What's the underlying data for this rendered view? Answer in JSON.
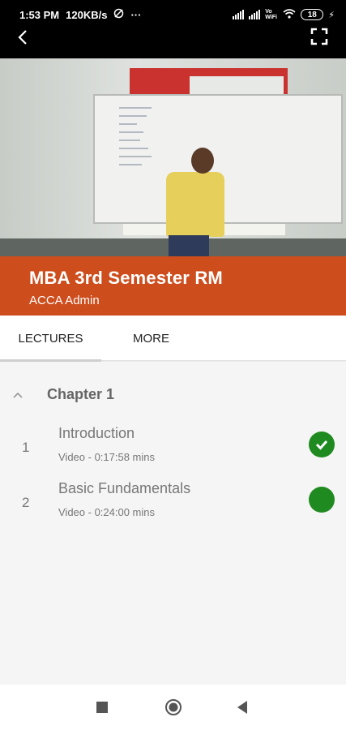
{
  "status_bar": {
    "time": "1:53 PM",
    "speed": "120KB/s",
    "more": "···",
    "volte": "Vo WiFi",
    "battery": "18"
  },
  "video": {
    "icons": {
      "back": "back-arrow-icon",
      "fullscreen": "fullscreen-icon"
    }
  },
  "course": {
    "title": "MBA 3rd Semester RM",
    "author": "ACCA Admin"
  },
  "tabs": [
    {
      "label": "LECTURES",
      "selected": true
    },
    {
      "label": "MORE",
      "selected": false
    }
  ],
  "chapter": {
    "title": "Chapter 1",
    "expanded": true,
    "lectures": [
      {
        "number": "1",
        "title": "Introduction",
        "meta": "Video - 0:17:58 mins",
        "status": "completed"
      },
      {
        "number": "2",
        "title": "Basic Fundamentals",
        "meta": "Video - 0:24:00 mins",
        "status": "in-progress"
      }
    ]
  },
  "colors": {
    "accent": "#cd4d1d",
    "status_green": "#1f8a1f"
  },
  "nav_bar": {
    "icons": [
      "recent-apps-icon",
      "home-icon",
      "back-icon"
    ]
  }
}
